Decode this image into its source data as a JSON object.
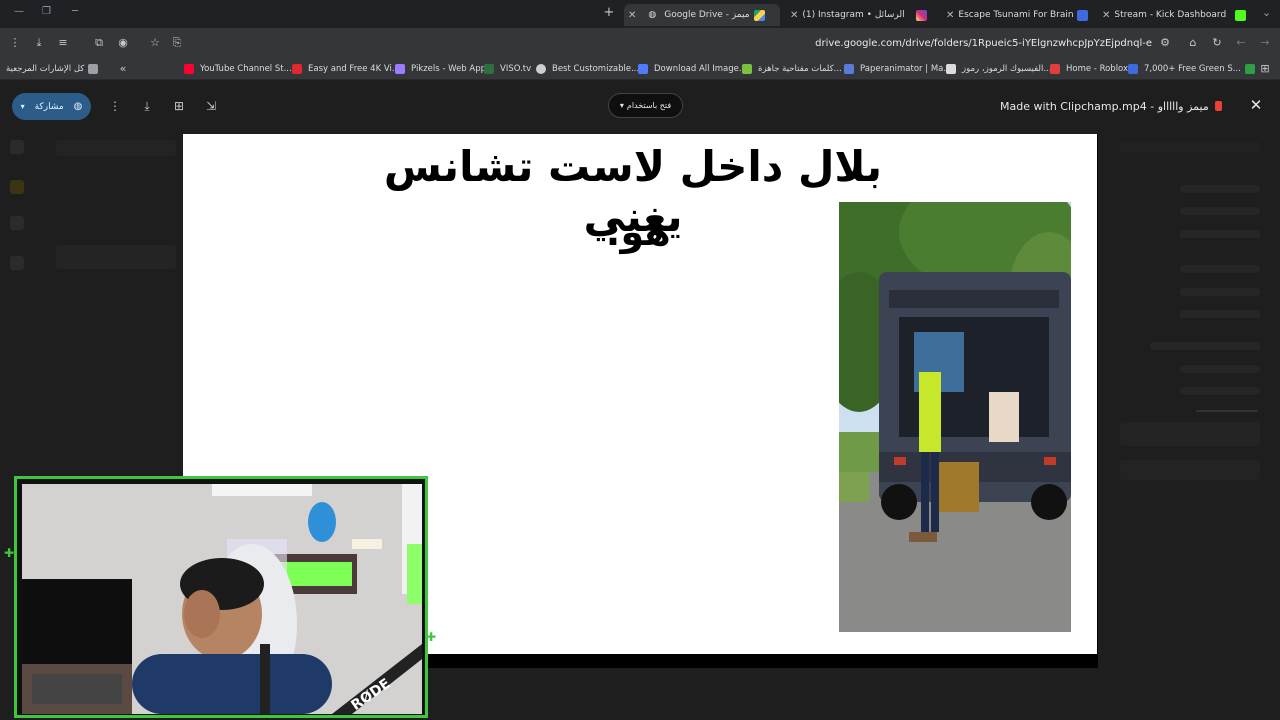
{
  "browser": {
    "tabs": [
      {
        "label": "Google Drive - ميمز",
        "active": true
      },
      {
        "label": "(1) Instagram • الرسائل",
        "active": false
      },
      {
        "label": "Escape Tsunami For Brainrots!",
        "active": false
      },
      {
        "label": "Stream - Kick Dashboard",
        "active": false
      }
    ],
    "url": "drive.google.com/drive/folders/1Rpueic5-iYElgnzwhcpJpYzEjpdnql-e",
    "bookmarks": [
      {
        "label": "كل الإشارات المرجعية",
        "color": "#9aa0a6"
      },
      {
        "label": "YouTube Channel St...",
        "color": "#ff0033"
      },
      {
        "label": "Easy and Free 4K Vi...",
        "color": "#e3262f"
      },
      {
        "label": "Pikzels - Web App",
        "color": "#9b7bff"
      },
      {
        "label": "VISO.tv",
        "color": "#2f6f3f"
      },
      {
        "label": "Best Customizable...",
        "color": "#cfcfcf"
      },
      {
        "label": "Download All Image...",
        "color": "#4f7cff"
      },
      {
        "label": "كلمات مفتاحية جاهزة...",
        "color": "#7ac142"
      },
      {
        "label": "Paperanimator | Ma...",
        "color": "#5a7bd8"
      },
      {
        "label": "الفيسبوك الرموز، رموز...",
        "color": "#dcdcdc"
      },
      {
        "label": "Home - Roblox",
        "color": "#e03d3d"
      },
      {
        "label": "7,000+ Free Green S...",
        "color": "#3d6bdf"
      }
    ]
  },
  "preview": {
    "share_label": "مشاركة",
    "open_with_label": "فتح باستخدام",
    "file_title": "Made with Clipchamp.mp4 - ميمز واااااو",
    "close_icon": "close-icon"
  },
  "slide": {
    "title": "بلال داخل لاست تشانس يغني",
    "subtitle": "هو:"
  },
  "colors": {
    "webcam_border": "#3ec83e",
    "share_bg": "#2c5d8a"
  }
}
